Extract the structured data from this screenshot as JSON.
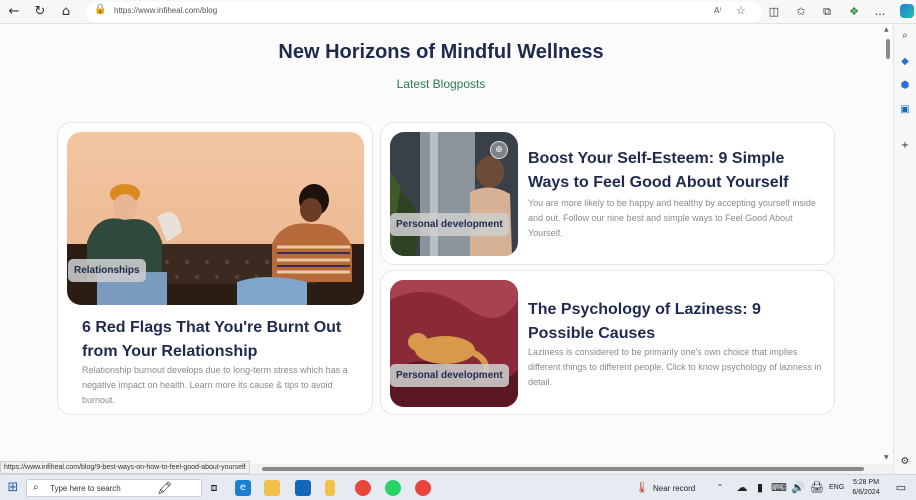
{
  "browser": {
    "url": "https://www.infiheal.com/blog",
    "read_aloud_label": "A⁾",
    "status_link": "https://www.infiheal.com/blog/9-best-ways-on-how-to-feel-good-about-yourself"
  },
  "page": {
    "title": "New Horizons of Mindful Wellness",
    "subtitle": "Latest Blogposts"
  },
  "posts": [
    {
      "tag": "Relationships",
      "title": "6 Red Flags That You're Burnt Out from Your Relationship",
      "description": "Relationship burnout develops due to long-term stress which has a negative impact on health. Learn more its cause & tips to avoid burnout."
    },
    {
      "tag": "Personal development",
      "title": "Boost Your Self-Esteem: 9 Simple Ways to Feel Good About Yourself",
      "description": "You are more likely to be happy and healthy by accepting yourself inside and out. Follow our nine best and simple ways to Feel Good About Yourself."
    },
    {
      "tag": "Personal development",
      "title": "The Psychology of Laziness: 9 Possible Causes",
      "description": "Laziness is considered to be primarily one's own choice that implies different things to different people. Click to know psychology of laziness in detail."
    }
  ],
  "taskbar": {
    "search_placeholder": "Type here to search",
    "weather": "Near record",
    "language": "ENG",
    "time": "5:28 PM",
    "date": "6/6/2024"
  },
  "colors": {
    "heading": "#1e2a4f",
    "subtitle": "#2a7d4f",
    "muted_text": "#8a8a8a"
  }
}
